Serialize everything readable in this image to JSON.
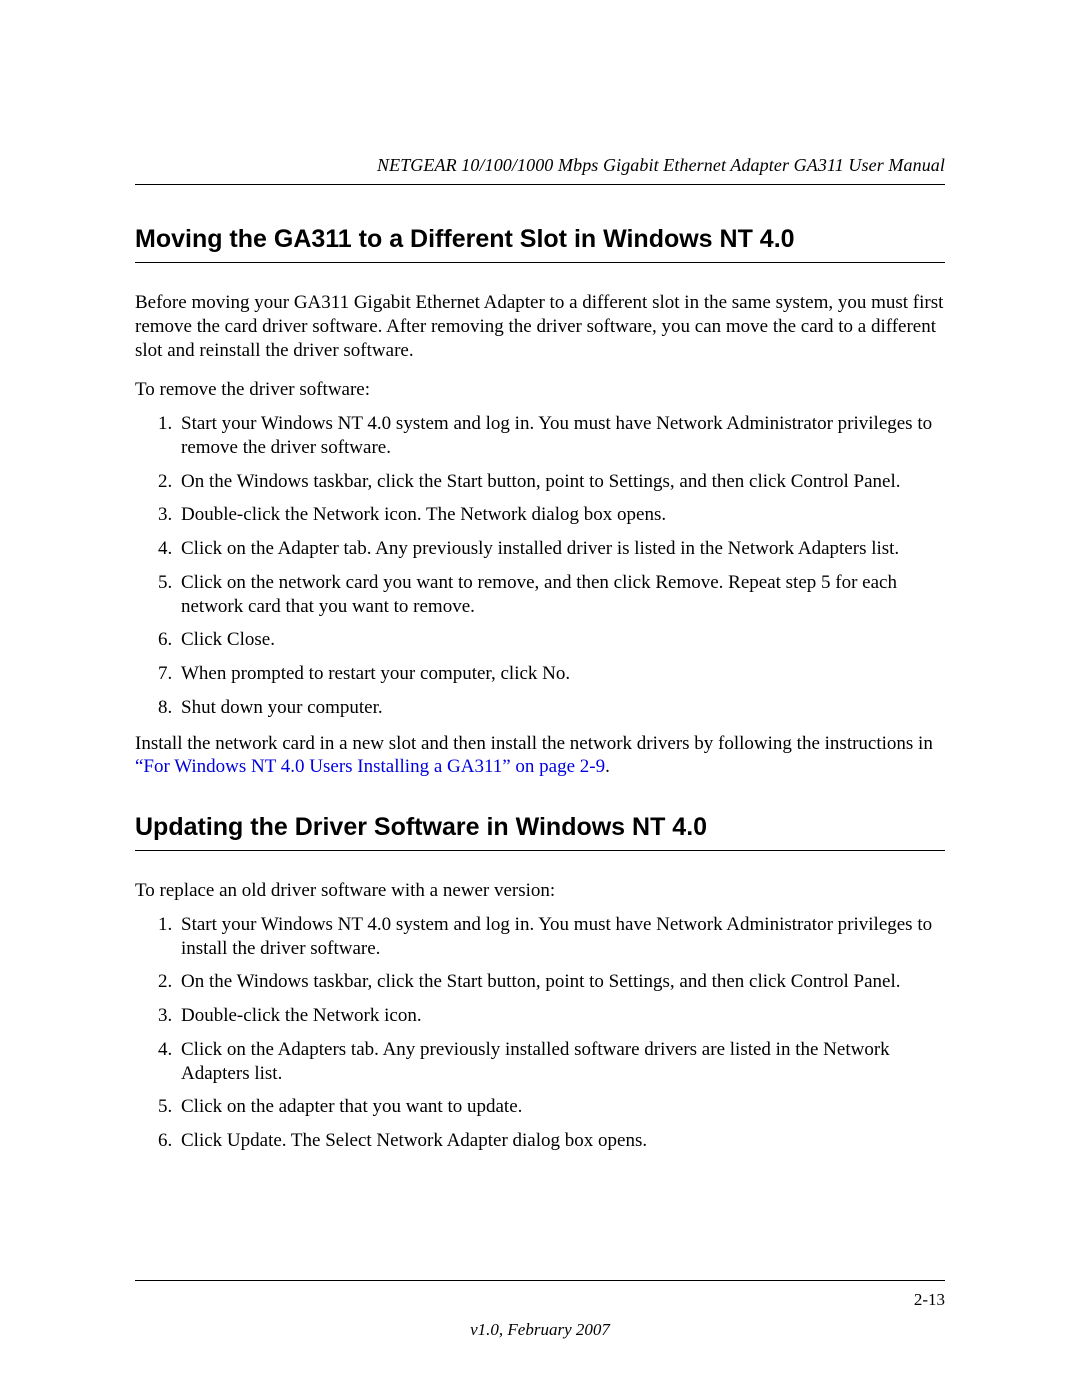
{
  "header": {
    "doc_title": "NETGEAR 10/100/1000 Mbps Gigabit Ethernet Adapter GA311 User Manual"
  },
  "section1": {
    "heading": "Moving the GA311 to a Different Slot in Windows NT 4.0",
    "intro": "Before moving your GA311 Gigabit Ethernet Adapter to a different slot in the same system, you must first remove the card driver software. After removing the driver software, you can move the card to a different slot and reinstall the driver software.",
    "lead": "To remove the driver software:",
    "steps": [
      "Start your Windows NT 4.0 system and log in. You must have Network Administrator privileges to remove the driver software.",
      "On the Windows taskbar, click the Start button, point to Settings, and then click Control Panel.",
      "Double-click the Network icon. The Network dialog box opens.",
      "Click on the Adapter tab. Any previously installed driver is listed in the Network Adapters list.",
      "Click on the network card you want to remove, and then click Remove. Repeat step 5 for each network card that you want to remove.",
      "Click Close.",
      "When prompted to restart your computer, click No.",
      "Shut down your computer."
    ],
    "after_pre": "Install the network card in a new slot and then install the network drivers by following the instructions in ",
    "after_link": "“For Windows NT 4.0 Users Installing a GA311” on page 2-9",
    "after_post": "."
  },
  "section2": {
    "heading": "Updating the Driver Software in Windows NT 4.0",
    "intro": "To replace an old driver software with a newer version:",
    "steps": [
      "Start your Windows NT 4.0 system and log in. You must have Network Administrator privileges to install the driver software.",
      "On the Windows taskbar, click the Start button, point to Settings, and then click Control Panel.",
      "Double-click the Network icon.",
      "Click on the Adapters tab. Any previously installed software drivers are listed in the Network Adapters list.",
      "Click on the adapter that you want to update.",
      "Click Update. The Select Network Adapter dialog box opens."
    ]
  },
  "footer": {
    "page_number": "2-13",
    "version": "v1.0, February 2007"
  }
}
